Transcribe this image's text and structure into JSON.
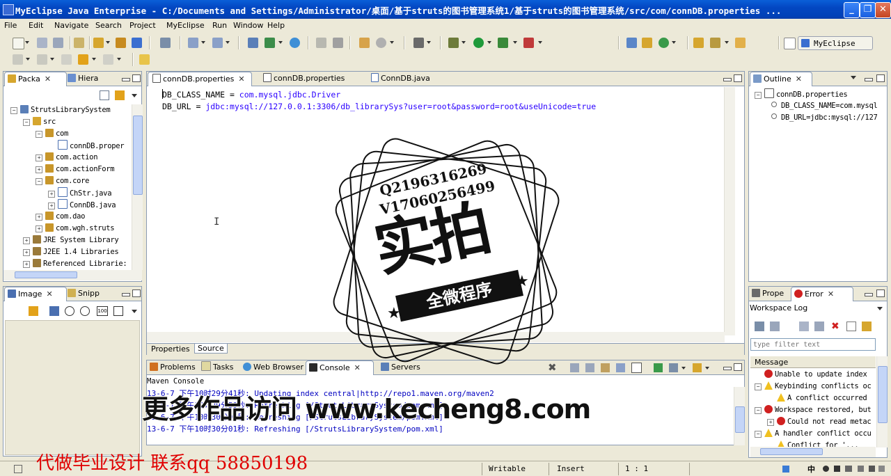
{
  "window": {
    "title": "MyEclipse Java Enterprise - C:/Documents and Settings/Administrator/桌面/基于struts的图书管理系统1/基于struts的图书管理系统/src/com/connDB.properties ..."
  },
  "menu": [
    "File",
    "Edit",
    "Navigate",
    "Search",
    "Project",
    "MyEclipse",
    "Run",
    "Window",
    "Help"
  ],
  "perspective": {
    "label": "MyEclipse ..."
  },
  "package_explorer": {
    "tabs": [
      "Packa",
      "Hiera"
    ],
    "tree": [
      {
        "label": "StrutsLibrarySystem",
        "level": 0,
        "expander": "-",
        "icon": "project"
      },
      {
        "label": "src",
        "level": 1,
        "expander": "-",
        "icon": "srcfolder"
      },
      {
        "label": "com",
        "level": 2,
        "expander": "-",
        "icon": "package"
      },
      {
        "label": "connDB.proper",
        "level": 3,
        "expander": "",
        "icon": "file"
      },
      {
        "label": "com.action",
        "level": 2,
        "expander": "+",
        "icon": "package"
      },
      {
        "label": "com.actionForm",
        "level": 2,
        "expander": "+",
        "icon": "package"
      },
      {
        "label": "com.core",
        "level": 2,
        "expander": "-",
        "icon": "package"
      },
      {
        "label": "ChStr.java",
        "level": 3,
        "expander": "+",
        "icon": "java"
      },
      {
        "label": "ConnDB.java",
        "level": 3,
        "expander": "+",
        "icon": "java"
      },
      {
        "label": "com.dao",
        "level": 2,
        "expander": "+",
        "icon": "package"
      },
      {
        "label": "com.wgh.struts",
        "level": 2,
        "expander": "+",
        "icon": "package"
      },
      {
        "label": "JRE System Library",
        "level": 0,
        "expander": "+",
        "icon": "library",
        "indent": 1
      },
      {
        "label": "J2EE 1.4 Libraries",
        "level": 0,
        "expander": "+",
        "icon": "library",
        "indent": 1
      },
      {
        "label": "Referenced Librarie:",
        "level": 0,
        "expander": "+",
        "icon": "library",
        "indent": 1
      }
    ]
  },
  "image_view": {
    "tabs": [
      "Image",
      "Snipp"
    ]
  },
  "editor": {
    "tabs": [
      "connDB.properties",
      "connDB.properties",
      "ConnDB.java"
    ],
    "lines": [
      {
        "key": "DB_CLASS_NAME",
        "eq": " = ",
        "value": "com.mysql.jdbc.Driver"
      },
      {
        "key": "DB_URL",
        "eq": " = ",
        "value": "jdbc:mysql://127.0.0.1:3306/db_librarySys?user=root&password=root&useUnicode=true"
      }
    ],
    "bottom_tabs": [
      "Properties",
      "Source"
    ]
  },
  "outline": {
    "tab": "Outline",
    "items": [
      {
        "label": "connDB.properties",
        "level": 0
      },
      {
        "label": "DB_CLASS_NAME=com.mysql",
        "level": 1
      },
      {
        "label": "DB_URL=jdbc:mysql://127",
        "level": 1
      }
    ]
  },
  "error_log": {
    "tabs": [
      "Prope",
      "Error"
    ],
    "workspace_label": "Workspace Log",
    "filter_placeholder": "type filter text",
    "column": "Message",
    "rows": [
      {
        "text": "Unable to update index",
        "icon": "error",
        "level": 0,
        "expander": ""
      },
      {
        "text": "Keybinding conflicts oc",
        "icon": "warning",
        "level": 0,
        "expander": "-"
      },
      {
        "text": "A conflict occurred",
        "icon": "warning",
        "level": 1,
        "expander": ""
      },
      {
        "text": "Workspace restored, but",
        "icon": "error",
        "level": 0,
        "expander": "-"
      },
      {
        "text": "Could not read metac",
        "icon": "error",
        "level": 1,
        "expander": "+"
      },
      {
        "text": "A handler conflict occu",
        "icon": "warning",
        "level": 0,
        "expander": "-"
      },
      {
        "text": "Conflict for '...",
        "icon": "warning",
        "level": 1,
        "expander": ""
      }
    ]
  },
  "console": {
    "tabs": [
      "Problems",
      "Tasks",
      "Web Browser",
      "Console",
      "Servers"
    ],
    "header": "Maven Console",
    "lines": [
      "13-6-7 下午10时29分41秒: Updating index central|http://repo1.maven.org/maven2",
      "13-6-7 下午10时29分59秒: Refreshing [/StrutsLibrarySystem/pom.xml]",
      "13-6-7 下午10时30分00秒: Refreshing [/StrutsLibrarySystem/pom.xml]",
      "13-6-7 下午10时30分01秒: Refreshing [/StrutsLibrarySystem/pom.xml]"
    ]
  },
  "statusbar": {
    "writable": "Writable",
    "insert": "Insert",
    "position": "1 : 1",
    "ime": "中"
  },
  "watermark": {
    "qq": "Q2196316269",
    "vx": "V17060256499",
    "big": "实拍",
    "ribbon": "全微程序",
    "site": "更多作品访问 www.kecheng8.com",
    "promo": "代做毕业设计  联系qq  58850198"
  },
  "colors": {
    "titlebar": "#0347c2",
    "key": "#000000",
    "value": "#2a00ff",
    "console_text": "#0000c0",
    "promo": "#e00000",
    "selection": "#c4d5f7"
  }
}
